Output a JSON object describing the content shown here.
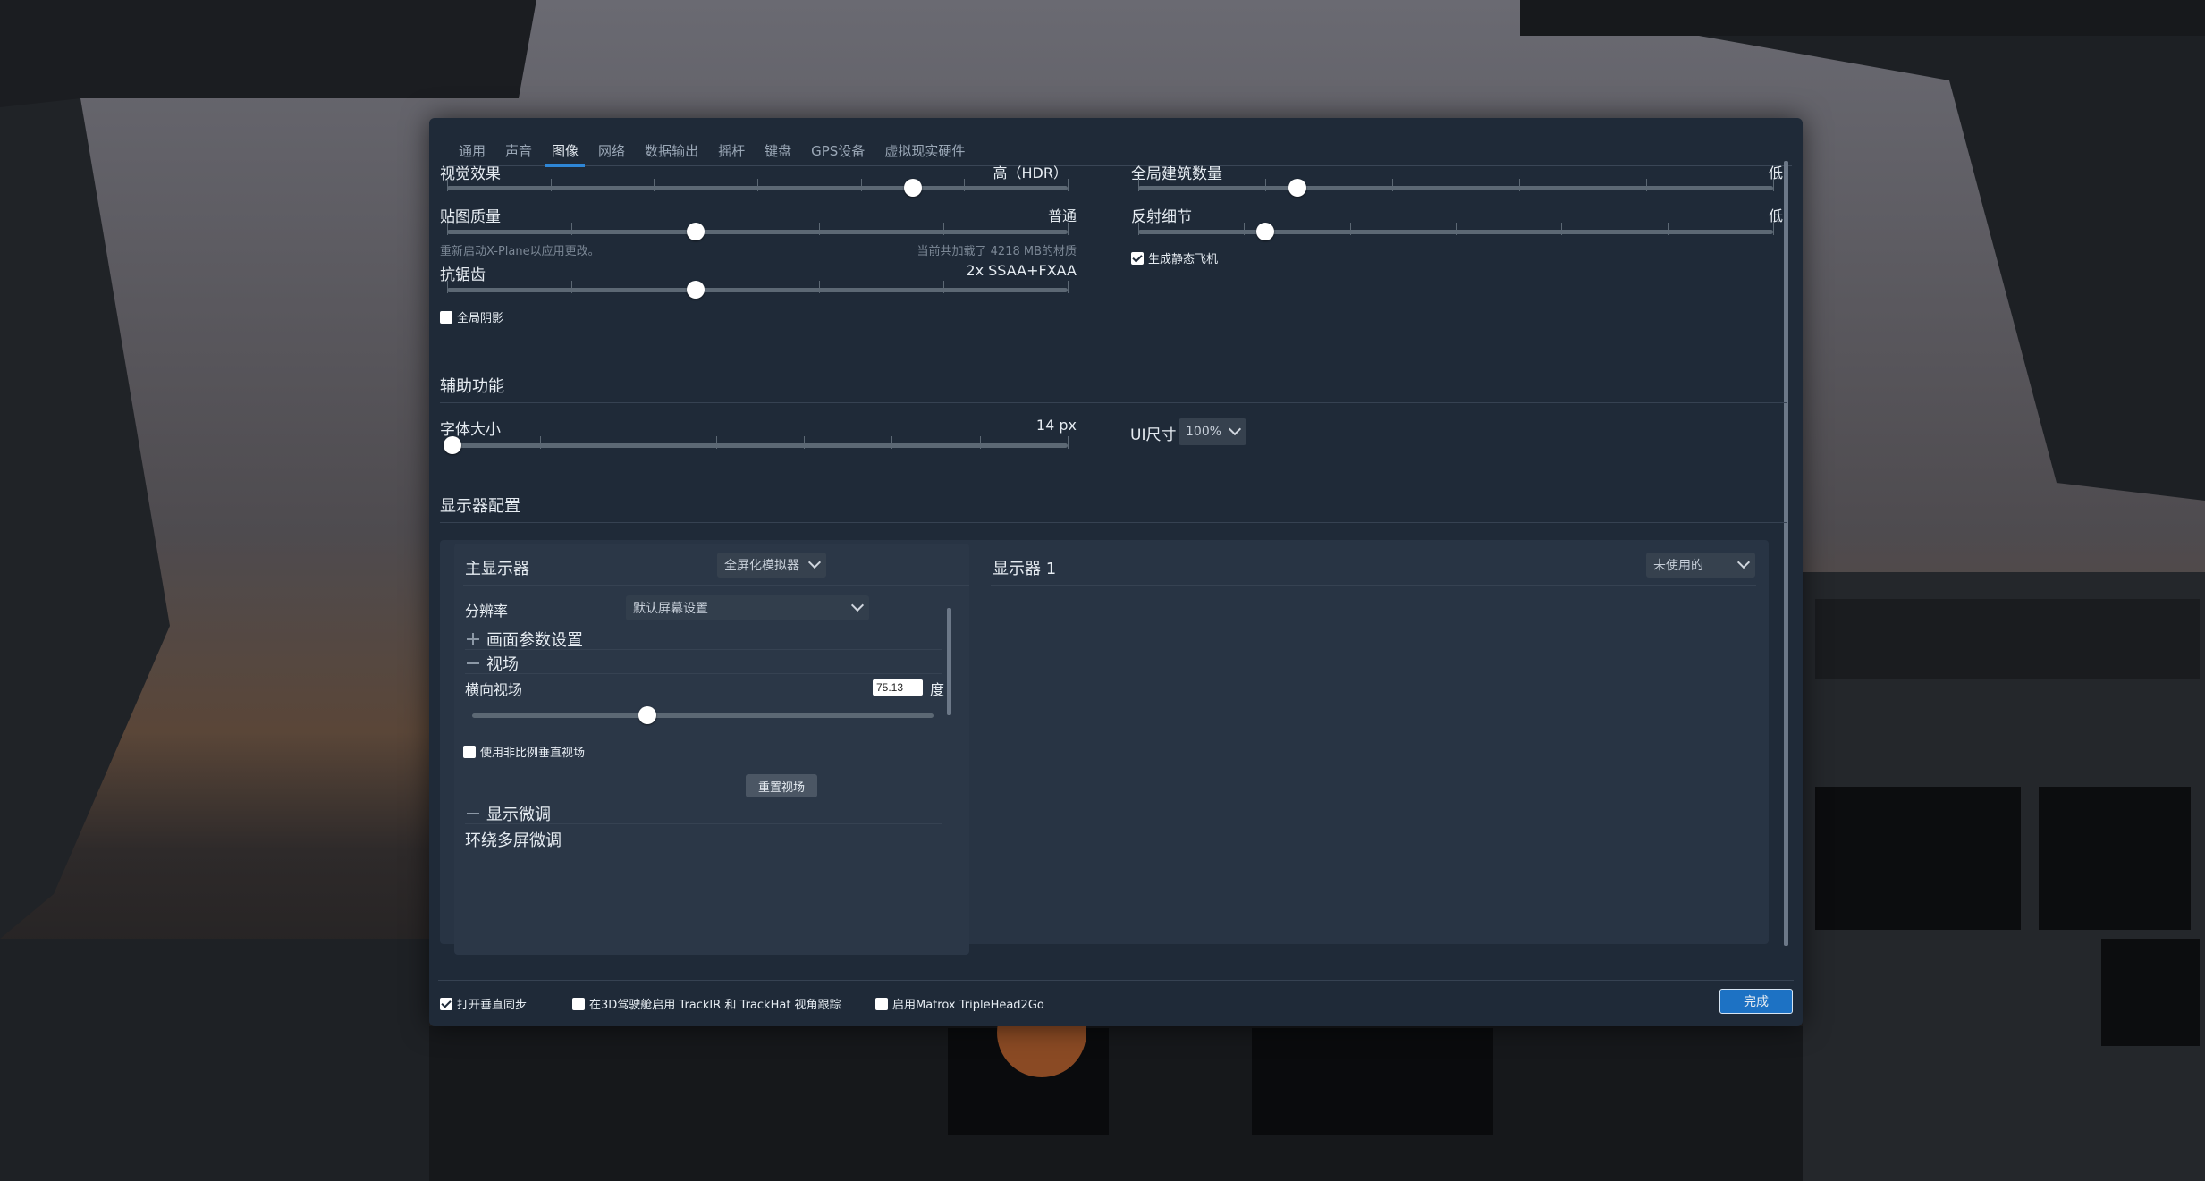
{
  "tabs": [
    "通用",
    "声音",
    "图像",
    "网络",
    "数据输出",
    "摇杆",
    "键盘",
    "GPS设备",
    "虚拟现实硬件"
  ],
  "active_tab": "图像",
  "graphics": {
    "visual_effects": {
      "label": "视觉效果",
      "value": "高（HDR）",
      "level": 0.75
    },
    "texture_quality": {
      "label": "贴图质量",
      "value": "普通",
      "level": 0.4,
      "hint_left": "重新启动X-Plane以应用更改。",
      "hint_right": "当前共加载了 4218 MB的材质"
    },
    "antialiasing": {
      "label": "抗锯齿",
      "value": "2x SSAA+FXAA",
      "level": 0.4
    },
    "global_shadows": {
      "label": "全局阴影",
      "checked": false
    },
    "world_objects": {
      "label": "全局建筑数量",
      "value": "低",
      "level": 0.25
    },
    "reflection_detail": {
      "label": "反射细节",
      "value": "低",
      "level": 0.2
    },
    "static_aircraft": {
      "label": "生成静态飞机",
      "checked": true
    }
  },
  "accessibility": {
    "title": "辅助功能",
    "font_size": {
      "label": "字体大小",
      "value": "14 px",
      "level": 0.0
    },
    "ui_size": {
      "label": "UI尺寸",
      "value": "100%"
    }
  },
  "monitor_config": {
    "title": "显示器配置",
    "primary": {
      "title": "主显示器",
      "mode": "全屏化模拟器",
      "resolution_label": "分辨率",
      "resolution_value": "默认屏幕设置",
      "graphics_settings": "画面参数设置",
      "field_of_view": "视场",
      "hfov_label": "横向视场",
      "hfov_value": "75.13",
      "hfov_unit": "度",
      "hfov_level": 0.38,
      "non_proportional": "使用非比例垂直视场",
      "reset_fov": "重置视场",
      "display_tuning": "显示微调",
      "surround_tuning": "环绕多屏微调"
    },
    "secondary": {
      "title": "显示器 1",
      "mode": "未使用的"
    }
  },
  "footer": {
    "vsync": {
      "label": "打开垂直同步",
      "checked": true
    },
    "trackir": {
      "label": "在3D驾驶舱启用 TrackIR 和 TrackHat 视角跟踪",
      "checked": false
    },
    "matrox": {
      "label": "启用Matrox TripleHead2Go",
      "checked": false
    },
    "done": "完成"
  },
  "colors": {
    "dialog_bg": "#1f2a38",
    "panel_bg": "#283444",
    "accent": "#2e86d6"
  }
}
